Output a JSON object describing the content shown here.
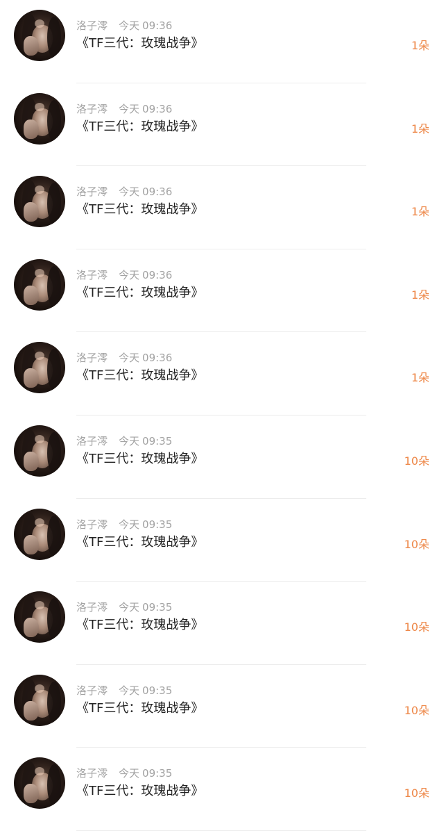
{
  "colors": {
    "meta_text": "#a3a3a3",
    "title_text": "#222222",
    "count_text": "#ee8a4c",
    "divider": "#ececec",
    "background": "#ffffff"
  },
  "records": [
    {
      "user": "洛子澪",
      "day": "今天",
      "time": "09:36",
      "title": "《TF三代：玫瑰战争》",
      "count": "1朵",
      "avatar_icon": "user-avatar-photo"
    },
    {
      "user": "洛子澪",
      "day": "今天",
      "time": "09:36",
      "title": "《TF三代：玫瑰战争》",
      "count": "1朵",
      "avatar_icon": "user-avatar-photo"
    },
    {
      "user": "洛子澪",
      "day": "今天",
      "time": "09:36",
      "title": "《TF三代：玫瑰战争》",
      "count": "1朵",
      "avatar_icon": "user-avatar-photo"
    },
    {
      "user": "洛子澪",
      "day": "今天",
      "time": "09:36",
      "title": "《TF三代：玫瑰战争》",
      "count": "1朵",
      "avatar_icon": "user-avatar-photo"
    },
    {
      "user": "洛子澪",
      "day": "今天",
      "time": "09:36",
      "title": "《TF三代：玫瑰战争》",
      "count": "1朵",
      "avatar_icon": "user-avatar-photo"
    },
    {
      "user": "洛子澪",
      "day": "今天",
      "time": "09:35",
      "title": "《TF三代：玫瑰战争》",
      "count": "10朵",
      "avatar_icon": "user-avatar-photo"
    },
    {
      "user": "洛子澪",
      "day": "今天",
      "time": "09:35",
      "title": "《TF三代：玫瑰战争》",
      "count": "10朵",
      "avatar_icon": "user-avatar-photo"
    },
    {
      "user": "洛子澪",
      "day": "今天",
      "time": "09:35",
      "title": "《TF三代：玫瑰战争》",
      "count": "10朵",
      "avatar_icon": "user-avatar-photo"
    },
    {
      "user": "洛子澪",
      "day": "今天",
      "time": "09:35",
      "title": "《TF三代：玫瑰战争》",
      "count": "10朵",
      "avatar_icon": "user-avatar-photo"
    },
    {
      "user": "洛子澪",
      "day": "今天",
      "time": "09:35",
      "title": "《TF三代：玫瑰战争》",
      "count": "10朵",
      "avatar_icon": "user-avatar-photo"
    }
  ]
}
